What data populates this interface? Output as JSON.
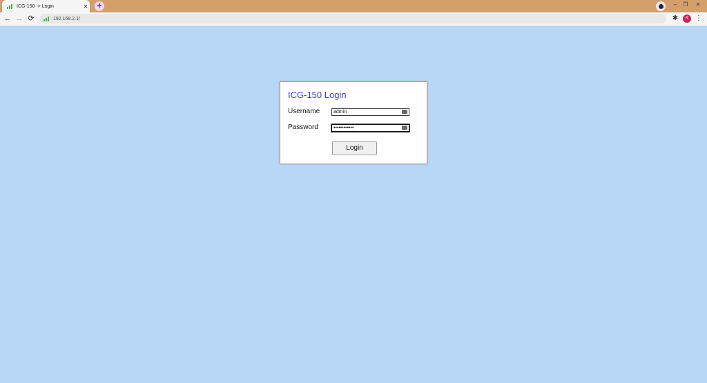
{
  "browser": {
    "tab_title": "ICG-150 -> Login",
    "tab_close": "✕",
    "new_tab": "+",
    "url": "192.168.2.1/",
    "avatar_initial": "R",
    "controls": {
      "minimize": "–",
      "restore": "❐",
      "close": "✕"
    },
    "nav": {
      "back": "←",
      "forward": "→",
      "reload": "⟳"
    },
    "extensions_icon": "extensions-icon",
    "menu": "⋮"
  },
  "login": {
    "title": "ICG-150 Login",
    "username_label": "Username",
    "username_value": "admin",
    "password_label": "Password",
    "password_value": "••••••••••••",
    "button_label": "Login"
  },
  "colors": {
    "page_background": "#b8d6f5",
    "tabstrip": "#d59f6c",
    "title": "#3b3bcc",
    "box_border": "#c58a8a"
  }
}
